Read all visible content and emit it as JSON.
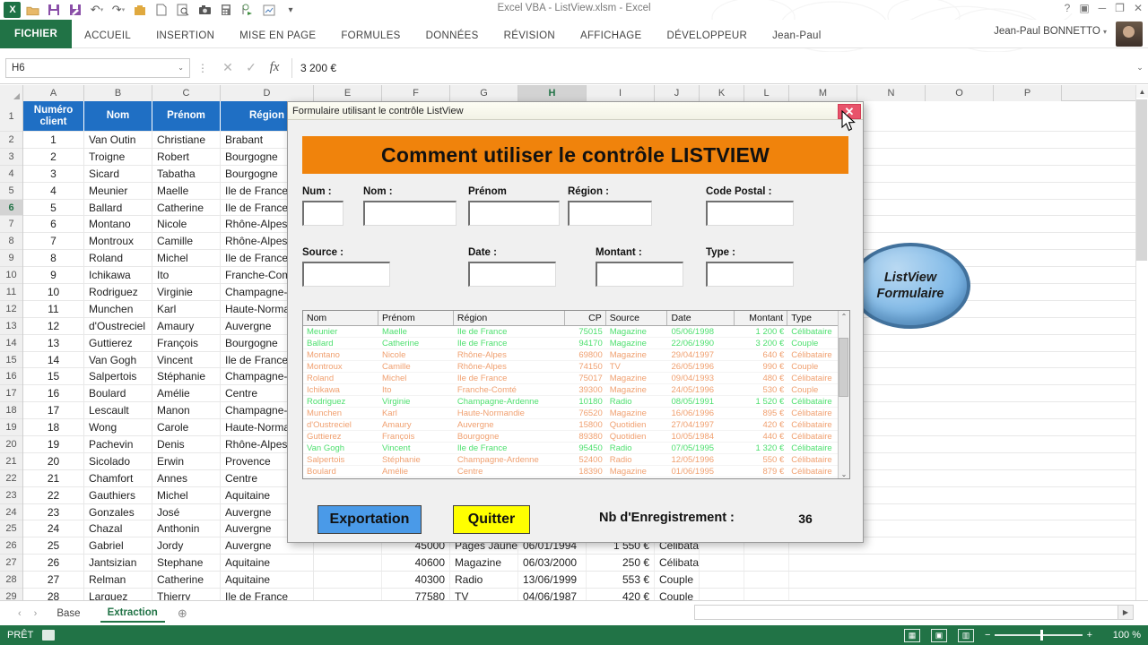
{
  "window": {
    "title": "Excel VBA - ListView.xlsm - Excel",
    "account": "Jean-Paul BONNETTO",
    "controls": {
      "help": "?",
      "ribbon_display": "▣",
      "minimize": "─",
      "restore": "❐",
      "close": "✕"
    }
  },
  "quick_access": [
    {
      "name": "excel-logo",
      "glyph": "X"
    },
    {
      "name": "open-folder-icon",
      "glyph": "Ὄ1"
    },
    {
      "name": "save-icon",
      "glyph": "▤"
    },
    {
      "name": "save-as-icon",
      "glyph": "▥"
    },
    {
      "name": "undo-icon",
      "glyph": "↶"
    },
    {
      "name": "redo-icon",
      "glyph": "↷"
    },
    {
      "name": "package-icon",
      "glyph": "■"
    },
    {
      "name": "new-file-icon",
      "glyph": "▭"
    },
    {
      "name": "print-preview-icon",
      "glyph": "▧"
    },
    {
      "name": "camera-icon",
      "glyph": "▣"
    },
    {
      "name": "calculator-icon",
      "glyph": "▦"
    },
    {
      "name": "macro-icon",
      "glyph": "▶"
    },
    {
      "name": "chart-icon",
      "glyph": "▨"
    },
    {
      "name": "customize-qat-icon",
      "glyph": "≡"
    }
  ],
  "ribbon": {
    "tabs": [
      {
        "label": "FICHIER",
        "active": true
      },
      {
        "label": "ACCUEIL",
        "active": false
      },
      {
        "label": "INSERTION",
        "active": false
      },
      {
        "label": "MISE EN PAGE",
        "active": false
      },
      {
        "label": "FORMULES",
        "active": false
      },
      {
        "label": "DONNÉES",
        "active": false
      },
      {
        "label": "RÉVISION",
        "active": false
      },
      {
        "label": "AFFICHAGE",
        "active": false
      },
      {
        "label": "DÉVELOPPEUR",
        "active": false
      },
      {
        "label": "Jean-Paul",
        "active": false
      }
    ]
  },
  "formula_bar": {
    "name_box": "H6",
    "value": "3 200 €",
    "cancel_icon": "✕",
    "accept_icon": "✓",
    "fx_icon": "fx",
    "expand_icon": "⌄"
  },
  "sheet": {
    "columns": [
      "A",
      "B",
      "C",
      "D",
      "E",
      "F",
      "G",
      "H",
      "I",
      "J",
      "K",
      "L",
      "M",
      "N",
      "O",
      "P"
    ],
    "selected_column": "H",
    "selected_row": 6,
    "headers": [
      "Numéro client",
      "Nom",
      "Prénom",
      "Région",
      "",
      "",
      "",
      "",
      ""
    ],
    "rows": [
      {
        "r": 2,
        "cells": [
          "1",
          "Van Outin",
          "Christiane",
          "Brabant"
        ]
      },
      {
        "r": 3,
        "cells": [
          "2",
          "Troigne",
          "Robert",
          "Bourgogne"
        ]
      },
      {
        "r": 4,
        "cells": [
          "3",
          "Sicard",
          "Tabatha",
          "Bourgogne"
        ]
      },
      {
        "r": 5,
        "cells": [
          "4",
          "Meunier",
          "Maelle",
          "Ile de France"
        ]
      },
      {
        "r": 6,
        "cells": [
          "5",
          "Ballard",
          "Catherine",
          "Ile de France"
        ]
      },
      {
        "r": 7,
        "cells": [
          "6",
          "Montano",
          "Nicole",
          "Rhône-Alpes"
        ]
      },
      {
        "r": 8,
        "cells": [
          "7",
          "Montroux",
          "Camille",
          "Rhône-Alpes"
        ]
      },
      {
        "r": 9,
        "cells": [
          "8",
          "Roland",
          "Michel",
          "Ile de France"
        ]
      },
      {
        "r": 10,
        "cells": [
          "9",
          "Ichikawa",
          "Ito",
          "Franche-Comté"
        ]
      },
      {
        "r": 11,
        "cells": [
          "10",
          "Rodriguez",
          "Virginie",
          "Champagne-Ardenne"
        ]
      },
      {
        "r": 12,
        "cells": [
          "11",
          "Munchen",
          "Karl",
          "Haute-Normandie"
        ]
      },
      {
        "r": 13,
        "cells": [
          "12",
          "d'Oustreciel",
          "Amaury",
          "Auvergne"
        ]
      },
      {
        "r": 14,
        "cells": [
          "13",
          "Guttierez",
          "François",
          "Bourgogne"
        ]
      },
      {
        "r": 15,
        "cells": [
          "14",
          "Van Gogh",
          "Vincent",
          "Ile de France"
        ]
      },
      {
        "r": 16,
        "cells": [
          "15",
          "Salpertois",
          "Stéphanie",
          "Champagne-Ardenne"
        ]
      },
      {
        "r": 17,
        "cells": [
          "16",
          "Boulard",
          "Amélie",
          "Centre"
        ]
      },
      {
        "r": 18,
        "cells": [
          "17",
          "Lescault",
          "Manon",
          "Champagne-Ardenne"
        ]
      },
      {
        "r": 19,
        "cells": [
          "18",
          "Wong",
          "Carole",
          "Haute-Normandie"
        ]
      },
      {
        "r": 20,
        "cells": [
          "19",
          "Pachevin",
          "Denis",
          "Rhône-Alpes"
        ]
      },
      {
        "r": 21,
        "cells": [
          "20",
          "Sicolado",
          "Erwin",
          "Provence"
        ]
      },
      {
        "r": 22,
        "cells": [
          "21",
          "Chamfort",
          "Annes",
          "Centre"
        ]
      },
      {
        "r": 23,
        "cells": [
          "22",
          "Gauthiers",
          "Michel",
          "Aquitaine"
        ]
      },
      {
        "r": 24,
        "cells": [
          "23",
          "Gonzales",
          "José",
          "Auvergne"
        ]
      },
      {
        "r": 25,
        "cells": [
          "24",
          "Chazal",
          "Anthonin",
          "Auvergne"
        ]
      },
      {
        "r": 26,
        "cells": [
          "25",
          "Gabriel",
          "Jordy",
          "Auvergne"
        ]
      },
      {
        "r": 27,
        "cells": [
          "26",
          "Jantsizian",
          "Stephane",
          "Aquitaine"
        ]
      },
      {
        "r": 28,
        "cells": [
          "27",
          "Relman",
          "Catherine",
          "Aquitaine"
        ]
      },
      {
        "r": 29,
        "cells": [
          "28",
          "Larquez",
          "Thierry",
          "Ile de France"
        ]
      }
    ],
    "visible_tail_rows": [
      {
        "r": 26,
        "cp": "45000",
        "source": "Pages Jaunes",
        "date": "06/01/1994",
        "montant": "1 550 €",
        "type": "Célibataire"
      },
      {
        "r": 27,
        "cp": "40600",
        "source": "Magazine",
        "date": "06/03/2000",
        "montant": "250 €",
        "type": "Célibataire"
      },
      {
        "r": 28,
        "cp": "40300",
        "source": "Radio",
        "date": "13/06/1999",
        "montant": "553 €",
        "type": "Couple"
      },
      {
        "r": 29,
        "cp": "77580",
        "source": "TV",
        "date": "04/06/1987",
        "montant": "420 €",
        "type": "Couple"
      }
    ],
    "shape_label_line1": "ListView",
    "shape_label_line2": "Formulaire"
  },
  "dialog": {
    "title": "Formulaire utilisant le contrôle ListView",
    "close_label": "✕",
    "banner": "Comment utiliser le contrôle LISTVIEW",
    "fields_row1": [
      {
        "label": "Num :",
        "value": "",
        "name": "num"
      },
      {
        "label": "Nom :",
        "value": "",
        "name": "nom"
      },
      {
        "label": "Prénom",
        "value": "",
        "name": "prenom"
      },
      {
        "label": "Région :",
        "value": "",
        "name": "region"
      },
      {
        "label": "Code Postal :",
        "value": "",
        "name": "code-postal"
      }
    ],
    "fields_row2": [
      {
        "label": "Source :",
        "value": "",
        "name": "source"
      },
      {
        "label": "Date  :",
        "value": "",
        "name": "date"
      },
      {
        "label": "Montant  :",
        "value": "",
        "name": "montant"
      },
      {
        "label": "Type  :",
        "value": "",
        "name": "type"
      }
    ],
    "listview": {
      "columns": [
        "Nom",
        "Prénom",
        "Région",
        "CP",
        "Source",
        "Date",
        "Montant",
        "Type"
      ],
      "rows": [
        {
          "highlight": true,
          "cells": [
            "Meunier",
            "Maelle",
            "Ile de France",
            "75015",
            "Magazine",
            "05/06/1998",
            "1 200 €",
            "Célibataire"
          ]
        },
        {
          "highlight": true,
          "cells": [
            "Ballard",
            "Catherine",
            "Ile de France",
            "94170",
            "Magazine",
            "22/06/1990",
            "3 200 €",
            "Couple"
          ]
        },
        {
          "highlight": false,
          "cells": [
            "Montano",
            "Nicole",
            "Rhône-Alpes",
            "69800",
            "Magazine",
            "29/04/1997",
            "640 €",
            "Célibataire"
          ]
        },
        {
          "highlight": false,
          "cells": [
            "Montroux",
            "Camille",
            "Rhône-Alpes",
            "74150",
            "TV",
            "26/05/1996",
            "990 €",
            "Couple"
          ]
        },
        {
          "highlight": false,
          "cells": [
            "Roland",
            "Michel",
            "Ile de France",
            "75017",
            "Magazine",
            "09/04/1993",
            "480 €",
            "Célibataire"
          ]
        },
        {
          "highlight": false,
          "cells": [
            "Ichikawa",
            "Ito",
            "Franche-Comté",
            "39300",
            "Magazine",
            "24/05/1996",
            "530 €",
            "Couple"
          ]
        },
        {
          "highlight": true,
          "cells": [
            "Rodriguez",
            "Virginie",
            "Champagne-Ardenne",
            "10180",
            "Radio",
            "08/05/1991",
            "1 520 €",
            "Célibataire"
          ]
        },
        {
          "highlight": false,
          "cells": [
            "Munchen",
            "Karl",
            "Haute-Normandie",
            "76520",
            "Magazine",
            "16/06/1996",
            "895 €",
            "Célibataire"
          ]
        },
        {
          "highlight": false,
          "cells": [
            "d'Oustreciel",
            "Amaury",
            "Auvergne",
            "15800",
            "Quotidien",
            "27/04/1997",
            "420 €",
            "Célibataire"
          ]
        },
        {
          "highlight": false,
          "cells": [
            "Guttierez",
            "François",
            "Bourgogne",
            "89380",
            "Quotidien",
            "10/05/1984",
            "440 €",
            "Célibataire"
          ]
        },
        {
          "highlight": true,
          "cells": [
            "Van Gogh",
            "Vincent",
            "Ile de France",
            "95450",
            "Radio",
            "07/05/1995",
            "1 320 €",
            "Célibataire"
          ]
        },
        {
          "highlight": false,
          "cells": [
            "Salpertois",
            "Stéphanie",
            "Champagne-Ardenne",
            "52400",
            "Radio",
            "12/05/1996",
            "550 €",
            "Célibataire"
          ]
        },
        {
          "highlight": false,
          "cells": [
            "Boulard",
            "Amélie",
            "Centre",
            "18390",
            "Magazine",
            "01/06/1995",
            "879 €",
            "Célibataire"
          ]
        }
      ],
      "scroll_up_icon": "⌃",
      "scroll_down_icon": "⌄"
    },
    "buttons": {
      "export": "Exportation",
      "quit": "Quitter"
    },
    "record_label": "Nb d'Enregistrement :",
    "record_count": "36"
  },
  "sheet_tabs": {
    "prev_icon": "‹",
    "next_icon": "›",
    "tabs": [
      {
        "label": "Base",
        "active": false
      },
      {
        "label": "Extraction",
        "active": true
      }
    ],
    "add_icon": "⊕"
  },
  "status_bar": {
    "state": "PRÊT",
    "views": [
      "normal-view",
      "page-layout-view",
      "page-break-view"
    ],
    "zoom_out": "−",
    "zoom_in": "+",
    "zoom_value": "100 %"
  },
  "colors": {
    "excel_green": "#217346",
    "header_blue": "#1f6fc4",
    "banner_orange": "#f0830c",
    "export_blue": "#4a9ae8",
    "quit_yellow": "#ffff00",
    "close_red": "#e8546a",
    "lv_green": "#4ddf6e",
    "lv_orange": "#f0a070"
  }
}
